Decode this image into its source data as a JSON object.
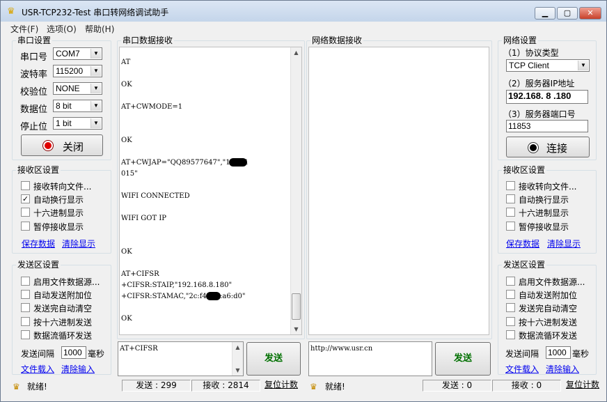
{
  "window": {
    "title": "USR-TCP232-Test 串口转网络调试助手",
    "minimize": "▁",
    "maximize": "▢",
    "close": "✕"
  },
  "menu": [
    {
      "label": "文件(F)"
    },
    {
      "label": "选项(O)"
    },
    {
      "label": "帮助(H)"
    }
  ],
  "serial_settings": {
    "title": "串口设置",
    "port_label": "串口号",
    "port_value": "COM7",
    "baud_label": "波特率",
    "baud_value": "115200",
    "parity_label": "校验位",
    "parity_value": "NONE",
    "databits_label": "数据位",
    "databits_value": "8 bit",
    "stopbits_label": "停止位",
    "stopbits_value": "1 bit",
    "close_button": "关闭"
  },
  "left_receive": {
    "title": "接收区设置",
    "options": [
      {
        "label": "接收转向文件...",
        "checked": false
      },
      {
        "label": "自动换行显示",
        "checked": true
      },
      {
        "label": "十六进制显示",
        "checked": false
      },
      {
        "label": "暂停接收显示",
        "checked": false
      }
    ],
    "save_link": "保存数据",
    "clear_link": "清除显示"
  },
  "left_send": {
    "title": "发送区设置",
    "options": [
      {
        "label": "启用文件数据源...",
        "checked": false
      },
      {
        "label": "自动发送附加位",
        "checked": false
      },
      {
        "label": "发送完自动清空",
        "checked": false
      },
      {
        "label": "按十六进制发送",
        "checked": false
      },
      {
        "label": "数据流循环发送",
        "checked": false
      }
    ],
    "interval_label": "发送间隔",
    "interval_value": "1000",
    "interval_unit": "毫秒",
    "load_link": "文件载入",
    "clear_link": "清除输入"
  },
  "serial_receive": {
    "title": "串口数据接收",
    "lines": [
      "AT",
      "OK",
      "AT+CWMODE=1",
      "OK",
      "AT+CWJAP=\"QQ89577647\",\"1zz   21",
      "015\"",
      "WIFI CONNECTED",
      "WIFI GOT IP",
      "OK",
      "AT+CIFSR",
      "+CIFSR:STAIP,\"192.168.8.180\"",
      "+CIFSR:STAMAC,\"2c:f4:   20:a6:d0\"",
      "OK"
    ]
  },
  "network_receive": {
    "title": "网络数据接收"
  },
  "serial_send": {
    "input": "AT+CIFSR",
    "send_button": "发送"
  },
  "network_send": {
    "input": "http://www.usr.cn",
    "send_button": "发送"
  },
  "network_settings": {
    "title": "网络设置",
    "protocol_label": "（1）协议类型",
    "protocol_value": "TCP Client",
    "ip_label": "（2）服务器IP地址",
    "ip_value": "192.168. 8 .180",
    "port_label": "（3）服务器端口号",
    "port_value": "11853",
    "connect_button": "连接"
  },
  "right_receive": {
    "title": "接收区设置",
    "options": [
      {
        "label": "接收转向文件...",
        "checked": false
      },
      {
        "label": "自动换行显示",
        "checked": false
      },
      {
        "label": "十六进制显示",
        "checked": false
      },
      {
        "label": "暂停接收显示",
        "checked": false
      }
    ],
    "save_link": "保存数据",
    "clear_link": "清除显示"
  },
  "right_send": {
    "title": "发送区设置",
    "options": [
      {
        "label": "启用文件数据源...",
        "checked": false
      },
      {
        "label": "自动发送附加位",
        "checked": false
      },
      {
        "label": "发送完自动清空",
        "checked": false
      },
      {
        "label": "按十六进制发送",
        "checked": false
      },
      {
        "label": "数据流循环发送",
        "checked": false
      }
    ],
    "interval_label": "发送间隔",
    "interval_value": "1000",
    "interval_unit": "毫秒",
    "load_link": "文件载入",
    "clear_link": "清除输入"
  },
  "status_left": {
    "ready": "就绪!",
    "sent": "发送 : 299",
    "received": "接收 : 2814",
    "reset": "复位计数"
  },
  "status_right": {
    "ready": "就绪!",
    "sent": "发送 : 0",
    "received": "接收 : 0",
    "reset": "复位计数"
  },
  "colors": {
    "send_text": "#007000",
    "link": "#0000ee",
    "record_dot": "#e00000"
  }
}
